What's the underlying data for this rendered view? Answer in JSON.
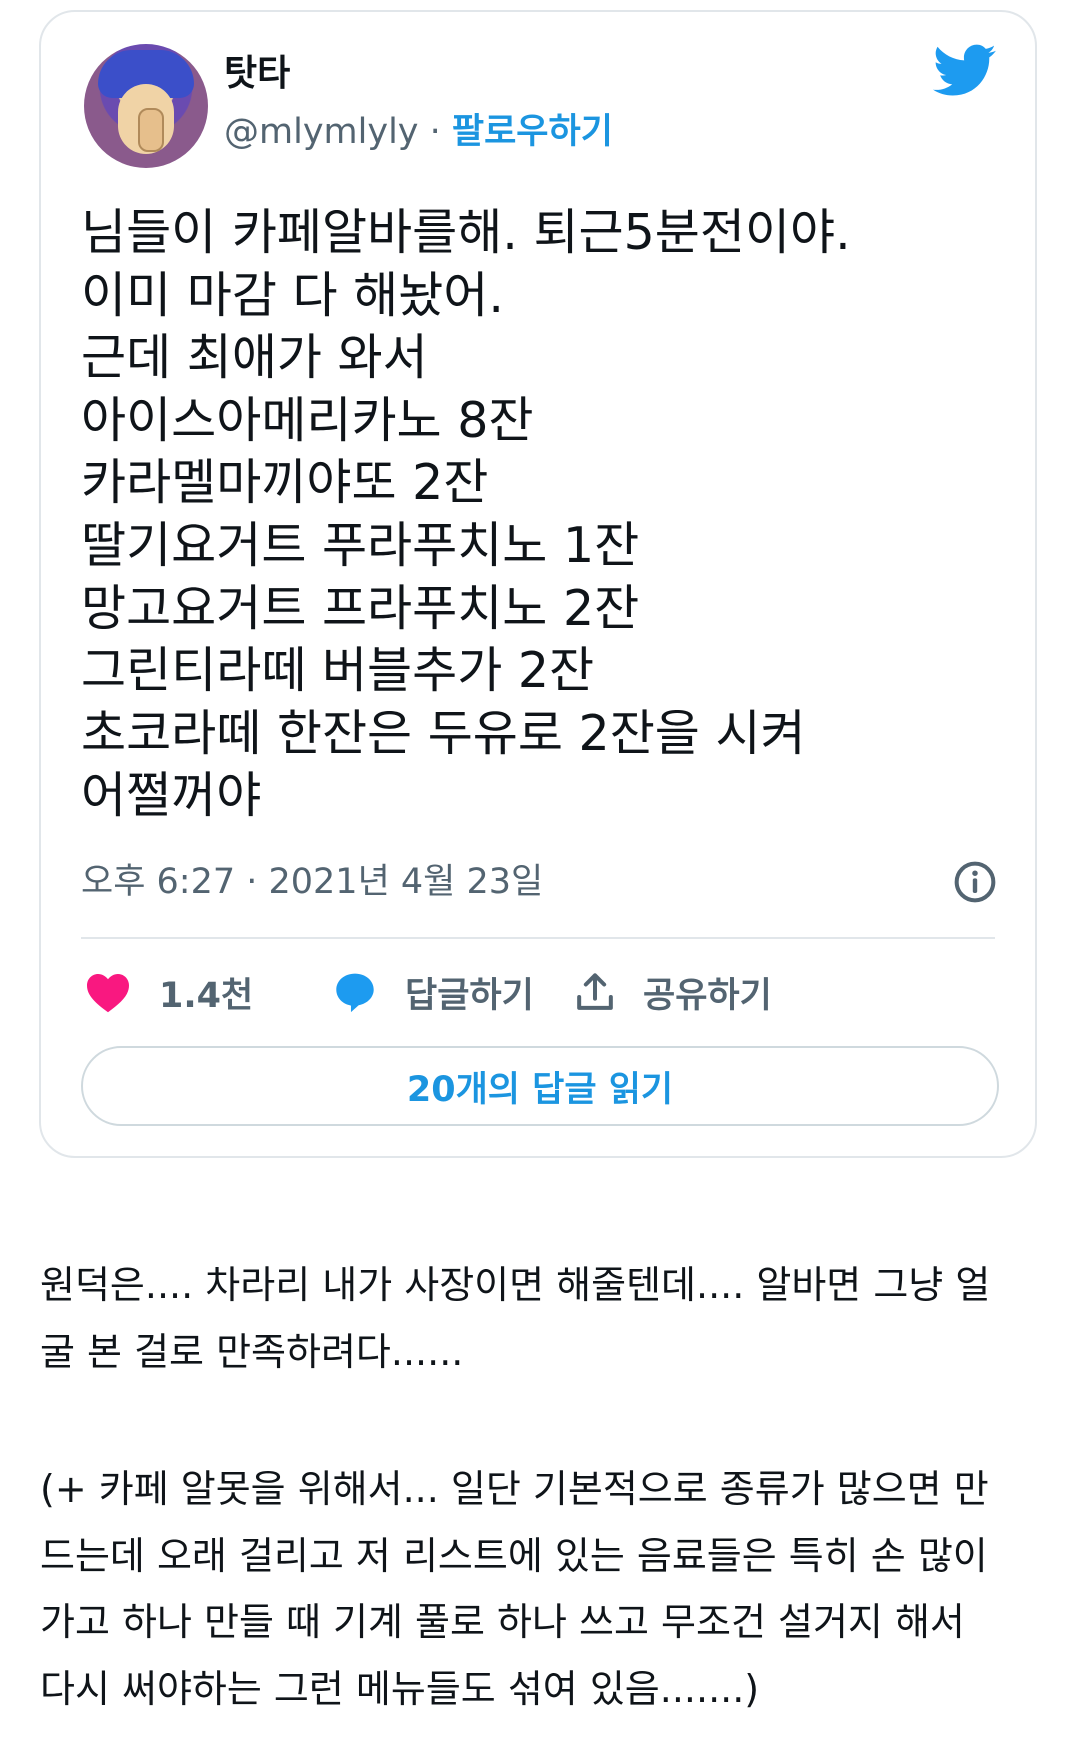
{
  "tweet": {
    "display_name": "탓타",
    "handle": "@mlymlyly",
    "separator": " · ",
    "follow_label": "팔로우하기",
    "text_lines": [
      "님들이 카페알바를해. 퇴근5분전이야.",
      "이미 마감 다 해놨어.",
      "근데 최애가 와서",
      "아이스아메리카노 8잔",
      "카라멜마끼야또 2잔",
      "딸기요거트 푸라푸치노 1잔",
      "망고요거트 프라푸치노 2잔",
      "그린티라떼 버블추가 2잔",
      "초코라떼 한잔은 두유로 2잔을 시켜",
      "어쩔꺼야"
    ],
    "timestamp": "오후 6:27 · 2021년 4월 23일",
    "likes": "1.4천",
    "reply_label": "답글하기",
    "share_label": "공유하기",
    "read_replies_label": "20개의 답글 읽기"
  },
  "colors": {
    "accent": "#1b95e0",
    "like": "#f91880",
    "muted": "#536471",
    "border": "#e1e6ea"
  },
  "icons": [
    "twitter-bird-icon",
    "info-icon",
    "heart-icon",
    "reply-bubble-icon",
    "share-icon"
  ],
  "commentary": {
    "paragraph1_lines": [
      "원덕은.... 차라리 내가 사장이면 해줄텐데.... 알바면 그냥 얼",
      "굴 본 걸로 만족하려다......"
    ],
    "paragraph2_lines": [
      "(+ 카페 알못을 위해서... 일단 기본적으로 종류가 많으면 만",
      "드는데 오래 걸리고 저 리스트에 있는 음료들은 특히 손 많이",
      "가고 하나 만들 때 기계 풀로 하나 쓰고 무조건 설거지 해서",
      "다시 써야하는 그런 메뉴들도 섞여 있음.......)"
    ]
  }
}
